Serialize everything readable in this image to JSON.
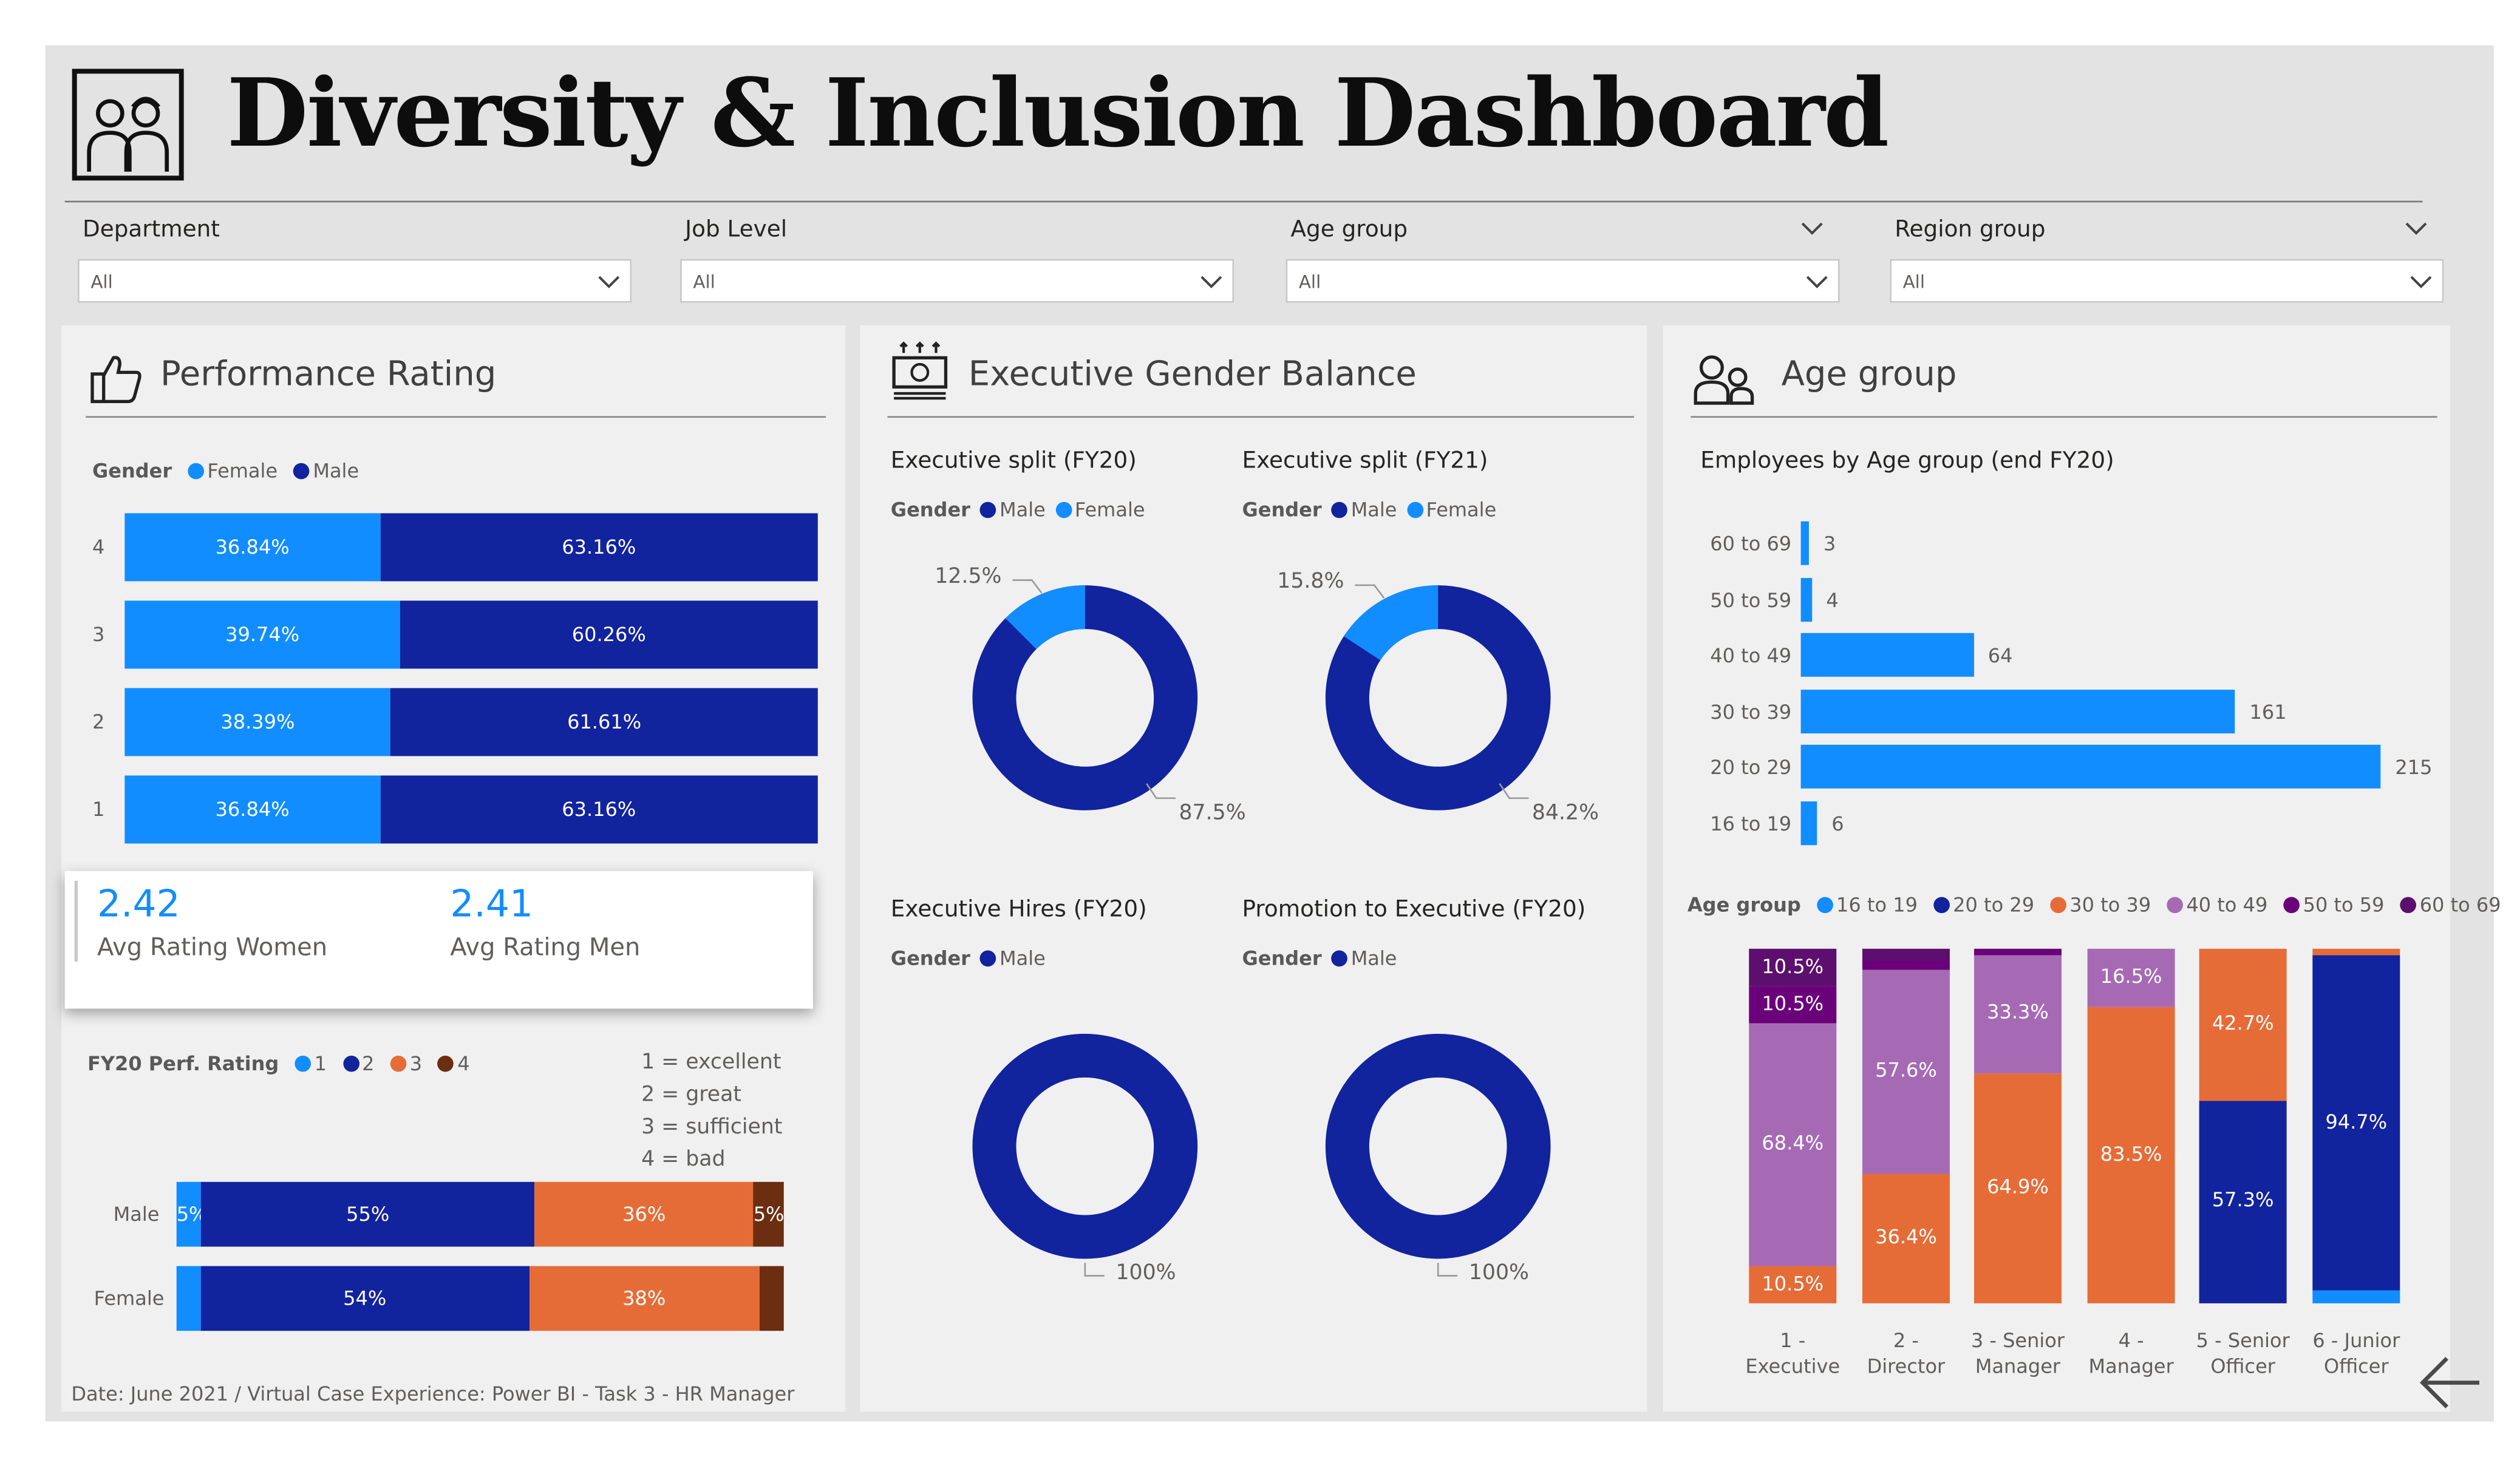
{
  "header": {
    "title": "Diversity & Inclusion Dashboard"
  },
  "colors": {
    "female": "#118dff",
    "male": "#12239e",
    "orange": "#e66c37",
    "lilac": "#a66ab5",
    "purple": "#6b007b",
    "brown": "#744ec2",
    "darkbrown": "#6b2e10"
  },
  "slicers": [
    {
      "label": "Department",
      "value": "All"
    },
    {
      "label": "Job Level",
      "value": "All"
    },
    {
      "label": "Age group",
      "value": "All"
    },
    {
      "label": "Region group",
      "value": "All"
    }
  ],
  "performance": {
    "title": "Performance Rating",
    "legend": {
      "title": "Gender",
      "items": [
        "Female",
        "Male"
      ]
    },
    "chart_data": {
      "type": "bar",
      "categories": [
        "4",
        "3",
        "2",
        "1"
      ],
      "series": [
        {
          "name": "Female",
          "values": [
            36.84,
            39.74,
            38.39,
            36.84
          ]
        },
        {
          "name": "Male",
          "values": [
            63.16,
            60.26,
            61.61,
            63.16
          ]
        }
      ],
      "labels": {
        "Female": [
          "36.84%",
          "39.74%",
          "38.39%",
          "36.84%"
        ],
        "Male": [
          "63.16%",
          "60.26%",
          "61.61%",
          "63.16%"
        ]
      }
    },
    "kpi": {
      "women_value": "2.42",
      "women_label": "Avg Rating Women",
      "men_value": "2.41",
      "men_label": "Avg Rating Men"
    },
    "rating_legend": {
      "title": "FY20 Perf. Rating",
      "items": [
        "1",
        "2",
        "3",
        "4"
      ]
    },
    "rating_key": [
      "1 = excellent",
      "2 = great",
      "3 = sufficient",
      "4 = bad"
    ],
    "rating_chart": {
      "type": "bar",
      "categories": [
        "Male",
        "Female"
      ],
      "series": [
        {
          "name": "1",
          "values": [
            4,
            4
          ]
        },
        {
          "name": "2",
          "values": [
            55,
            54
          ]
        },
        {
          "name": "3",
          "values": [
            36,
            38
          ]
        },
        {
          "name": "4",
          "values": [
            5,
            4
          ]
        }
      ],
      "labels": {
        "Male": [
          "5%",
          "55%",
          "36%",
          "5%"
        ],
        "Female": [
          "",
          "54%",
          "38%",
          ""
        ]
      }
    },
    "footer": "Date: June 2021 / Virtual Case Experience: Power BI - Task 3 - HR Manager"
  },
  "executive": {
    "title": "Executive Gender Balance",
    "donuts": [
      {
        "title": "Executive split (FY20)",
        "legend_title": "Gender",
        "legend": [
          "Male",
          "Female"
        ],
        "chart_data": {
          "type": "pie",
          "labels": [
            "Female",
            "Male"
          ],
          "values": [
            12.5,
            87.5
          ]
        },
        "label_small": "12.5%",
        "label_big": "87.5%"
      },
      {
        "title": "Executive split (FY21)",
        "legend_title": "Gender",
        "legend": [
          "Male",
          "Female"
        ],
        "chart_data": {
          "type": "pie",
          "labels": [
            "Female",
            "Male"
          ],
          "values": [
            15.8,
            84.2
          ]
        },
        "label_small": "15.8%",
        "label_big": "84.2%"
      },
      {
        "title": "Executive Hires (FY20)",
        "legend_title": "Gender",
        "legend": [
          "Male"
        ],
        "chart_data": {
          "type": "pie",
          "labels": [
            "Male"
          ],
          "values": [
            100
          ]
        },
        "label_big": "100%"
      },
      {
        "title": "Promotion to Executive (FY20)",
        "legend_title": "Gender",
        "legend": [
          "Male"
        ],
        "chart_data": {
          "type": "pie",
          "labels": [
            "Male"
          ],
          "values": [
            100
          ]
        },
        "label_big": "100%"
      }
    ]
  },
  "age": {
    "title": "Age group",
    "subtitle": "Employees by Age group (end FY20)",
    "chart_data": {
      "type": "bar",
      "categories": [
        "60 to 69",
        "50 to 59",
        "40 to 49",
        "30 to 39",
        "20 to 29",
        "16 to 19"
      ],
      "values": [
        3,
        4,
        64,
        161,
        215,
        6
      ]
    },
    "legend": {
      "title": "Age group",
      "items": [
        "16 to 19",
        "20 to 29",
        "30 to 39",
        "40 to 49",
        "50 to 59",
        "60 to 69"
      ]
    },
    "stack_chart": {
      "type": "bar",
      "categories": [
        "1 - Executive",
        "2 - Director",
        "3 - Senior Manager",
        "4 - Manager",
        "5 - Senior Officer",
        "6 - Junior Officer"
      ],
      "category_lines": [
        [
          "1 -",
          "Executive"
        ],
        [
          "2 -",
          "Director"
        ],
        [
          "3 - Senior",
          "Manager"
        ],
        [
          "4 -",
          "Manager"
        ],
        [
          "5 - Senior",
          "Officer"
        ],
        [
          "6 - Junior",
          "Officer"
        ]
      ],
      "series": [
        {
          "name": "16 to 19",
          "values": [
            0,
            0,
            0,
            0,
            0,
            3.5
          ]
        },
        {
          "name": "20 to 29",
          "values": [
            0,
            0,
            0,
            0,
            57.3,
            94.7
          ]
        },
        {
          "name": "30 to 39",
          "values": [
            10.5,
            36.4,
            64.9,
            83.5,
            42.7,
            1.8
          ]
        },
        {
          "name": "40 to 49",
          "values": [
            68.4,
            57.6,
            33.3,
            16.5,
            0,
            0
          ]
        },
        {
          "name": "50 to 59",
          "values": [
            10.5,
            3.0,
            1.8,
            0,
            0,
            0
          ]
        },
        {
          "name": "60 to 69",
          "values": [
            10.5,
            3.0,
            0,
            0,
            0,
            0
          ]
        }
      ],
      "labels": [
        [
          "",
          "",
          "10.5%",
          "68.4%",
          "10.5%",
          "10.5%"
        ],
        [
          "",
          "",
          "36.4%",
          "57.6%",
          "",
          ""
        ],
        [
          "",
          "",
          "64.9%",
          "33.3%",
          "",
          ""
        ],
        [
          "",
          "",
          "83.5%",
          "16.5%",
          "",
          ""
        ],
        [
          "",
          "57.3%",
          "42.7%",
          "",
          "",
          ""
        ],
        [
          "",
          "94.7%",
          "",
          "",
          "",
          ""
        ]
      ]
    }
  }
}
